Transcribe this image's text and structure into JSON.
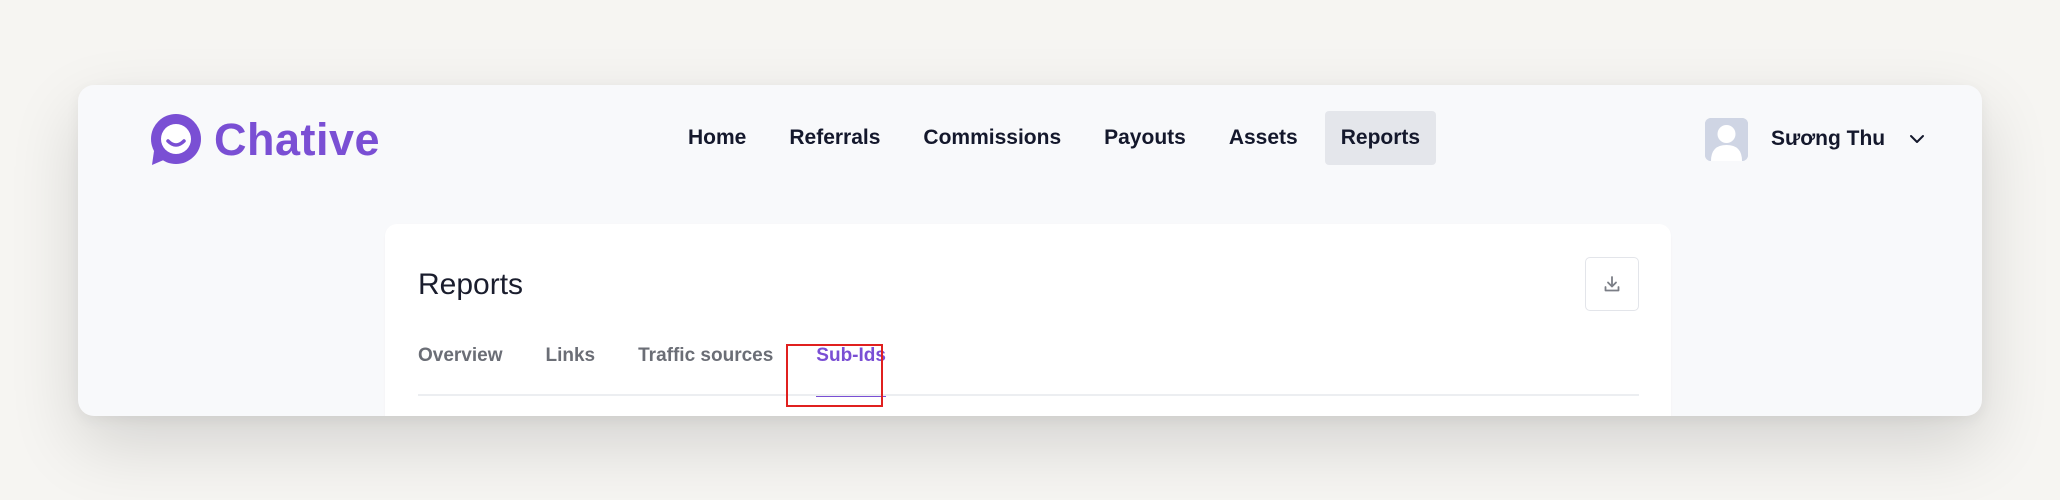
{
  "header": {
    "logo_text": "Chative",
    "nav": [
      {
        "label": "Home",
        "active": false
      },
      {
        "label": "Referrals",
        "active": false
      },
      {
        "label": "Commissions",
        "active": false
      },
      {
        "label": "Payouts",
        "active": false
      },
      {
        "label": "Assets",
        "active": false
      },
      {
        "label": "Reports",
        "active": true
      }
    ],
    "user_name": "Sương Thu"
  },
  "card": {
    "title": "Reports",
    "tabs": [
      {
        "label": "Overview",
        "active": false
      },
      {
        "label": "Links",
        "active": false
      },
      {
        "label": "Traffic sources",
        "active": false
      },
      {
        "label": "Sub-Ids",
        "active": true
      }
    ]
  },
  "colors": {
    "brand": "#7a4fd4",
    "highlight": "#e0201f",
    "nav_active_bg": "#e4e6eb"
  },
  "icons": {
    "logo": "chat-bubble-smile-icon",
    "avatar": "user-silhouette-icon",
    "user_menu": "chevron-down-icon",
    "download": "download-icon"
  }
}
